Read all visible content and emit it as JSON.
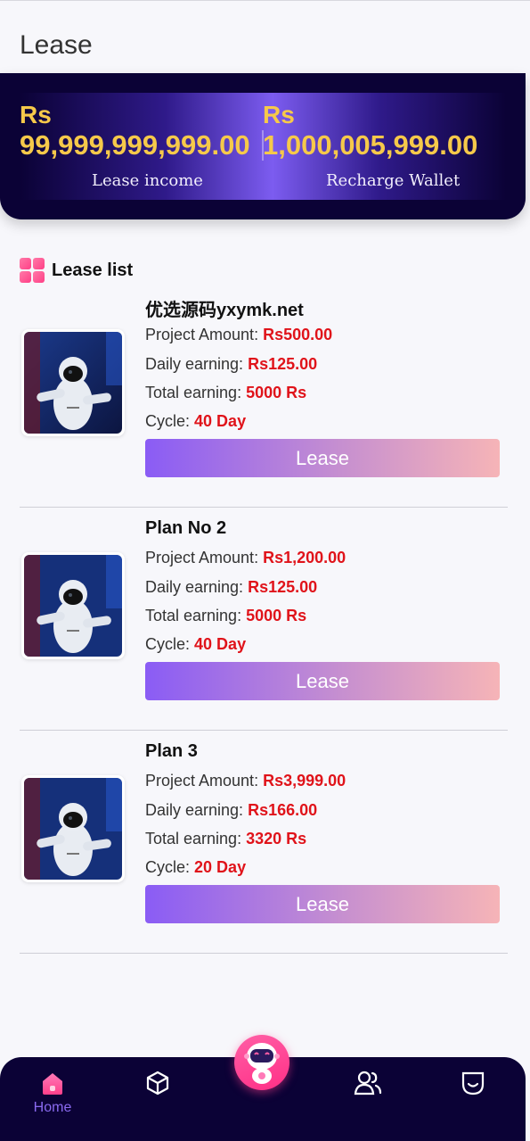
{
  "header": {
    "title": "Lease"
  },
  "wallet": {
    "left": {
      "currency": "Rs",
      "amount": "99,999,999,999.00",
      "label": "Lease income"
    },
    "right": {
      "currency": "Rs",
      "amount": "1,000,005,999.00",
      "label": "Recharge Wallet"
    }
  },
  "section": {
    "title": "Lease list",
    "icon": "grid-icon"
  },
  "plans": [
    {
      "name": "优选源码yxymk.net",
      "amount_label": "Project Amount:",
      "amount": "Rs500.00",
      "daily_label": "Daily earning:",
      "daily": "Rs125.00",
      "total_label": "Total earning:",
      "total": "5000 Rs",
      "cycle_label": "Cycle:",
      "cycle": "40 Day",
      "button": "Lease"
    },
    {
      "name": "Plan No 2",
      "amount_label": "Project Amount:",
      "amount": "Rs1,200.00",
      "daily_label": "Daily earning:",
      "daily": "Rs125.00",
      "total_label": "Total earning:",
      "total": "5000 Rs",
      "cycle_label": "Cycle:",
      "cycle": "40 Day",
      "button": "Lease"
    },
    {
      "name": "Plan 3",
      "amount_label": "Project Amount:",
      "amount": "Rs3,999.00",
      "daily_label": "Daily earning:",
      "daily": "Rs166.00",
      "total_label": "Total earning:",
      "total": "3320 Rs",
      "cycle_label": "Cycle:",
      "cycle": "20 Day",
      "button": "Lease"
    }
  ],
  "nav": {
    "items": [
      {
        "label": "Home",
        "icon": "home-icon",
        "active": true
      },
      {
        "label": "",
        "icon": "cube-icon"
      },
      {
        "label": "",
        "icon": "robot-icon"
      },
      {
        "label": "",
        "icon": "users-icon"
      },
      {
        "label": "",
        "icon": "profile-icon"
      }
    ]
  },
  "colors": {
    "accent": "#e0131a",
    "gold": "#f6c94a",
    "nav_bg": "#0b0236",
    "active": "#8a6af0"
  }
}
